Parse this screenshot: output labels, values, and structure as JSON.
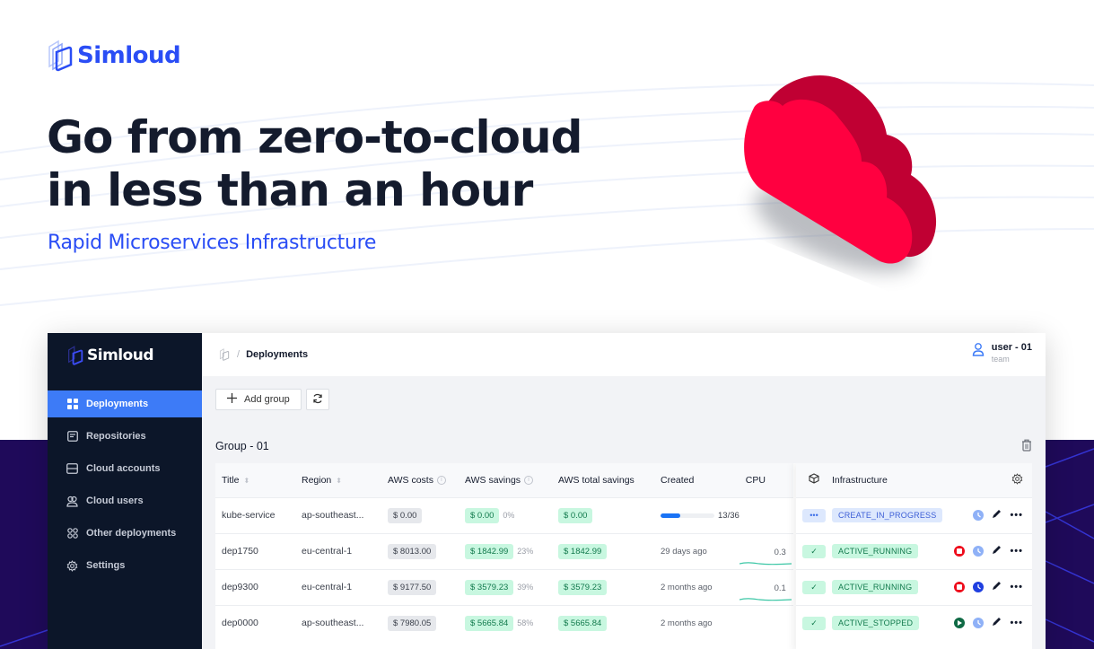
{
  "hero": {
    "brand": "Simloud",
    "headline_line1": "Go from zero-to-cloud",
    "headline_line2": "in less than an hour",
    "subheadline": "Rapid Microservices Infrastructure",
    "brand_color": "#2a4df5",
    "cloud_color": "#ff0040"
  },
  "app": {
    "brand": "Simloud",
    "sidebar": {
      "items": [
        {
          "label": "Deployments",
          "icon": "grid-icon",
          "active": true
        },
        {
          "label": "Repositories",
          "icon": "document-icon",
          "active": false
        },
        {
          "label": "Cloud accounts",
          "icon": "server-icon",
          "active": false
        },
        {
          "label": "Cloud users",
          "icon": "users-icon",
          "active": false
        },
        {
          "label": "Other deployments",
          "icon": "circles-grid-icon",
          "active": false
        },
        {
          "label": "Settings",
          "icon": "gear-icon",
          "active": false
        }
      ]
    },
    "breadcrumb": {
      "separator": "/",
      "current": "Deployments"
    },
    "user": {
      "name": "user - 01",
      "role": "team"
    },
    "toolbar": {
      "add_group_label": "Add group"
    },
    "group": {
      "title": "Group - 01",
      "columns": {
        "title": "Title",
        "region": "Region",
        "aws_costs": "AWS costs",
        "aws_savings": "AWS savings",
        "aws_total_savings": "AWS total savings",
        "created": "Created",
        "cpu": "CPU",
        "infrastructure": "Infrastructure",
        "info_glyph": "i"
      },
      "rows": [
        {
          "title": "kube-service",
          "region": "ap-southeast...",
          "aws_costs": "$ 0.00",
          "aws_savings": "$ 0.00",
          "savings_pct": "0%",
          "aws_total_savings": "$ 0.00",
          "created": "",
          "progress_text": "13/36",
          "progress": 0.3611,
          "cpu": "",
          "status_badge": "•••",
          "status_badge_type": "blue",
          "infrastructure": "CREATE_IN_PROGRESS",
          "infra_type": "blue",
          "primary_action": "none",
          "schedule_active": false
        },
        {
          "title": "dep1750",
          "region": "eu-central-1",
          "aws_costs": "$ 8013.00",
          "aws_savings": "$ 1842.99",
          "savings_pct": "23%",
          "aws_total_savings": "$ 1842.99",
          "created": "29 days ago",
          "progress_text": "",
          "progress": null,
          "cpu": "0.3",
          "status_badge": "✓",
          "status_badge_type": "green",
          "infrastructure": "ACTIVE_RUNNING",
          "infra_type": "green",
          "primary_action": "stop",
          "schedule_active": false
        },
        {
          "title": "dep9300",
          "region": "eu-central-1",
          "aws_costs": "$ 9177.50",
          "aws_savings": "$ 3579.23",
          "savings_pct": "39%",
          "aws_total_savings": "$ 3579.23",
          "created": "2 months ago",
          "progress_text": "",
          "progress": null,
          "cpu": "0.1",
          "status_badge": "✓",
          "status_badge_type": "green",
          "infrastructure": "ACTIVE_RUNNING",
          "infra_type": "green",
          "primary_action": "stop",
          "schedule_active": true
        },
        {
          "title": "dep0000",
          "region": "ap-southeast...",
          "aws_costs": "$ 7980.05",
          "aws_savings": "$ 5665.84",
          "savings_pct": "58%",
          "aws_total_savings": "$ 5665.84",
          "created": "2 months ago",
          "progress_text": "",
          "progress": null,
          "cpu": "",
          "status_badge": "✓",
          "status_badge_type": "green",
          "infrastructure": "ACTIVE_STOPPED",
          "infra_type": "green",
          "primary_action": "play",
          "schedule_active": false
        }
      ]
    },
    "colors": {
      "sidebar_bg": "#0c1629",
      "active_nav": "#3d7bf7",
      "stop_red": "#ee0b1b",
      "play_green": "#0f6a45",
      "schedule_active": "#1f3fe0",
      "schedule_inactive": "#8fb1f7",
      "sparkline": "#3cc7a6"
    }
  }
}
